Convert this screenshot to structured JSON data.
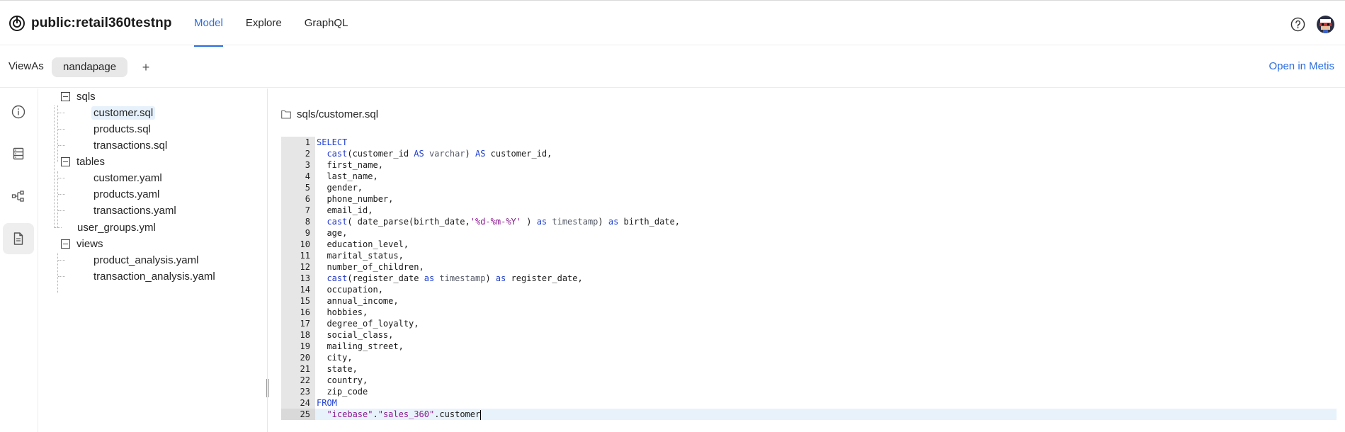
{
  "header": {
    "title": "public:retail360testnp",
    "tabs": [
      {
        "label": "Model",
        "active": true
      },
      {
        "label": "Explore",
        "active": false
      },
      {
        "label": "GraphQL",
        "active": false
      }
    ],
    "icons": [
      "logo-icon",
      "help-icon",
      "avatar"
    ]
  },
  "viewbar": {
    "label": "ViewAs",
    "chip": "nandapage",
    "add_label": "+",
    "open_link": "Open in Metis"
  },
  "rail": {
    "items": [
      "info-icon",
      "database-icon",
      "lineage-icon",
      "file-icon"
    ],
    "active": "file-icon"
  },
  "tree": {
    "folders": [
      {
        "name": "sqls",
        "files": [
          "customer.sql",
          "products.sql",
          "transactions.sql"
        ]
      },
      {
        "name": "tables",
        "files": [
          "customer.yaml",
          "products.yaml",
          "transactions.yaml"
        ]
      },
      {
        "name": "views",
        "files": [
          "product_analysis.yaml",
          "transaction_analysis.yaml"
        ]
      }
    ],
    "root_files": [
      "user_groups.yml"
    ],
    "selected": "customer.sql"
  },
  "editor": {
    "path": "sqls/customer.sql",
    "current_line": 25,
    "lines": [
      [
        [
          "kw",
          "SELECT"
        ]
      ],
      [
        [
          "",
          "  "
        ],
        [
          "fn",
          "cast"
        ],
        [
          "",
          "(customer_id "
        ],
        [
          "kw",
          "AS"
        ],
        [
          "",
          ""
        ],
        [
          "ty",
          " varchar"
        ],
        [
          "",
          ") "
        ],
        [
          "kw",
          "AS"
        ],
        [
          "",
          " customer_id,"
        ]
      ],
      [
        [
          "",
          "  first_name,"
        ]
      ],
      [
        [
          "",
          "  last_name,"
        ]
      ],
      [
        [
          "",
          "  gender,"
        ]
      ],
      [
        [
          "",
          "  phone_number,"
        ]
      ],
      [
        [
          "",
          "  email_id,"
        ]
      ],
      [
        [
          "",
          "  "
        ],
        [
          "fn",
          "cast"
        ],
        [
          "",
          "( date_parse(birth_date,"
        ],
        [
          "str",
          "'%d-%m-%Y'"
        ],
        [
          "",
          " ) "
        ],
        [
          "kw",
          "as"
        ],
        [
          "ty",
          " timestamp"
        ],
        [
          "",
          ") "
        ],
        [
          "kw",
          "as"
        ],
        [
          "",
          " birth_date,"
        ]
      ],
      [
        [
          "",
          "  age,"
        ]
      ],
      [
        [
          "",
          "  education_level,"
        ]
      ],
      [
        [
          "",
          "  marital_status,"
        ]
      ],
      [
        [
          "",
          "  number_of_children,"
        ]
      ],
      [
        [
          "",
          "  "
        ],
        [
          "fn",
          "cast"
        ],
        [
          "",
          "(register_date "
        ],
        [
          "kw",
          "as"
        ],
        [
          "ty",
          " timestamp"
        ],
        [
          "",
          ") "
        ],
        [
          "kw",
          "as"
        ],
        [
          "",
          " register_date,"
        ]
      ],
      [
        [
          "",
          "  occupation,"
        ]
      ],
      [
        [
          "",
          "  annual_income,"
        ]
      ],
      [
        [
          "",
          "  hobbies,"
        ]
      ],
      [
        [
          "",
          "  degree_of_loyalty,"
        ]
      ],
      [
        [
          "",
          "  social_class,"
        ]
      ],
      [
        [
          "",
          "  mailing_street,"
        ]
      ],
      [
        [
          "",
          "  city,"
        ]
      ],
      [
        [
          "",
          "  state,"
        ]
      ],
      [
        [
          "",
          "  country,"
        ]
      ],
      [
        [
          "",
          "  zip_code"
        ]
      ],
      [
        [
          "kw",
          "FROM"
        ]
      ],
      [
        [
          "",
          "  "
        ],
        [
          "str",
          "\"icebase\""
        ],
        [
          "",
          "."
        ],
        [
          "str",
          "\"sales_360\""
        ],
        [
          "",
          ".customer"
        ]
      ]
    ]
  }
}
